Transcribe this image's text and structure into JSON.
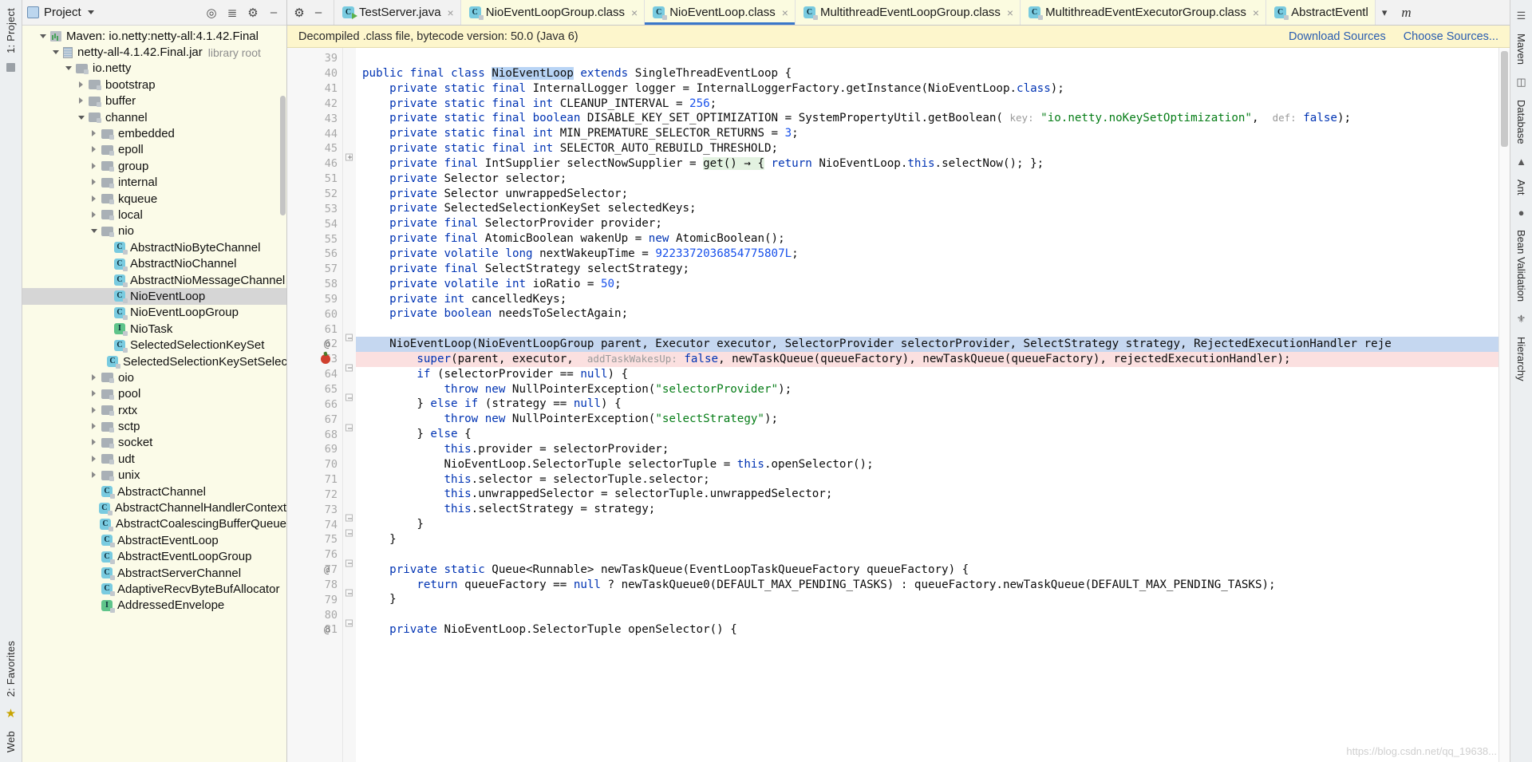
{
  "left_toolbar": {
    "top_label": "1: Project",
    "bottom_labels": [
      "2: Favorites",
      "Web"
    ]
  },
  "project_panel": {
    "title": "Project",
    "icons": [
      "target-icon",
      "collapse-all-icon",
      "settings-gear-icon",
      "hide-icon"
    ],
    "tree": [
      {
        "depth": 1,
        "twisty": "down",
        "icon": "maven-icon",
        "label": "Maven: io.netty:netty-all:4.1.42.Final",
        "dim": ""
      },
      {
        "depth": 2,
        "twisty": "down",
        "icon": "jar-icon",
        "label": "netty-all-4.1.42.Final.jar",
        "dim": "library root"
      },
      {
        "depth": 3,
        "twisty": "down",
        "icon": "folder-icon",
        "label": "io.netty",
        "dim": ""
      },
      {
        "depth": 4,
        "twisty": "right",
        "icon": "folder-icon",
        "label": "bootstrap",
        "dim": ""
      },
      {
        "depth": 4,
        "twisty": "right",
        "icon": "folder-icon",
        "label": "buffer",
        "dim": ""
      },
      {
        "depth": 4,
        "twisty": "down",
        "icon": "folder-icon",
        "label": "channel",
        "dim": ""
      },
      {
        "depth": 5,
        "twisty": "right",
        "icon": "folder-icon",
        "label": "embedded",
        "dim": ""
      },
      {
        "depth": 5,
        "twisty": "right",
        "icon": "folder-icon",
        "label": "epoll",
        "dim": ""
      },
      {
        "depth": 5,
        "twisty": "right",
        "icon": "folder-icon",
        "label": "group",
        "dim": ""
      },
      {
        "depth": 5,
        "twisty": "right",
        "icon": "folder-icon",
        "label": "internal",
        "dim": ""
      },
      {
        "depth": 5,
        "twisty": "right",
        "icon": "folder-icon",
        "label": "kqueue",
        "dim": ""
      },
      {
        "depth": 5,
        "twisty": "right",
        "icon": "folder-icon",
        "label": "local",
        "dim": ""
      },
      {
        "depth": 5,
        "twisty": "down",
        "icon": "folder-icon",
        "label": "nio",
        "dim": ""
      },
      {
        "depth": 6,
        "twisty": "none",
        "icon": "class-icon",
        "label": "AbstractNioByteChannel",
        "dim": ""
      },
      {
        "depth": 6,
        "twisty": "none",
        "icon": "class-icon",
        "label": "AbstractNioChannel",
        "dim": ""
      },
      {
        "depth": 6,
        "twisty": "none",
        "icon": "class-icon",
        "label": "AbstractNioMessageChannel",
        "dim": ""
      },
      {
        "depth": 6,
        "twisty": "none",
        "icon": "class-icon",
        "label": "NioEventLoop",
        "dim": "",
        "selected": true
      },
      {
        "depth": 6,
        "twisty": "none",
        "icon": "class-icon",
        "label": "NioEventLoopGroup",
        "dim": ""
      },
      {
        "depth": 6,
        "twisty": "none",
        "icon": "interface-icon",
        "label": "NioTask",
        "dim": ""
      },
      {
        "depth": 6,
        "twisty": "none",
        "icon": "class-icon",
        "label": "SelectedSelectionKeySet",
        "dim": ""
      },
      {
        "depth": 6,
        "twisty": "none",
        "icon": "class-icon",
        "label": "SelectedSelectionKeySetSelect",
        "dim": ""
      },
      {
        "depth": 5,
        "twisty": "right",
        "icon": "folder-icon",
        "label": "oio",
        "dim": ""
      },
      {
        "depth": 5,
        "twisty": "right",
        "icon": "folder-icon",
        "label": "pool",
        "dim": ""
      },
      {
        "depth": 5,
        "twisty": "right",
        "icon": "folder-icon",
        "label": "rxtx",
        "dim": ""
      },
      {
        "depth": 5,
        "twisty": "right",
        "icon": "folder-icon",
        "label": "sctp",
        "dim": ""
      },
      {
        "depth": 5,
        "twisty": "right",
        "icon": "folder-icon",
        "label": "socket",
        "dim": ""
      },
      {
        "depth": 5,
        "twisty": "right",
        "icon": "folder-icon",
        "label": "udt",
        "dim": ""
      },
      {
        "depth": 5,
        "twisty": "right",
        "icon": "folder-icon",
        "label": "unix",
        "dim": ""
      },
      {
        "depth": 5,
        "twisty": "none",
        "icon": "class-icon",
        "label": "AbstractChannel",
        "dim": ""
      },
      {
        "depth": 5,
        "twisty": "none",
        "icon": "class-icon",
        "label": "AbstractChannelHandlerContext",
        "dim": ""
      },
      {
        "depth": 5,
        "twisty": "none",
        "icon": "class-icon",
        "label": "AbstractCoalescingBufferQueue",
        "dim": ""
      },
      {
        "depth": 5,
        "twisty": "none",
        "icon": "class-icon",
        "label": "AbstractEventLoop",
        "dim": ""
      },
      {
        "depth": 5,
        "twisty": "none",
        "icon": "class-icon",
        "label": "AbstractEventLoopGroup",
        "dim": ""
      },
      {
        "depth": 5,
        "twisty": "none",
        "icon": "class-icon",
        "label": "AbstractServerChannel",
        "dim": ""
      },
      {
        "depth": 5,
        "twisty": "none",
        "icon": "class-icon",
        "label": "AdaptiveRecvByteBufAllocator",
        "dim": ""
      },
      {
        "depth": 5,
        "twisty": "none",
        "icon": "interface-icon",
        "label": "AddressedEnvelope",
        "dim": ""
      }
    ]
  },
  "tabs": [
    {
      "label": "TestServer.java",
      "icon": "java-run-icon",
      "active": false,
      "closable": true
    },
    {
      "label": "NioEventLoopGroup.class",
      "icon": "class-file-icon",
      "active": false,
      "closable": true
    },
    {
      "label": "NioEventLoop.class",
      "icon": "class-file-icon",
      "active": true,
      "closable": true
    },
    {
      "label": "MultithreadEventLoopGroup.class",
      "icon": "class-file-icon",
      "active": false,
      "closable": true
    },
    {
      "label": "MultithreadEventExecutorGroup.class",
      "icon": "class-file-icon",
      "active": false,
      "closable": true
    },
    {
      "label": "AbstractEventl",
      "icon": "class-file-icon",
      "active": false,
      "closable": false
    }
  ],
  "tab_overflow_icon": "chevron-down-icon",
  "tab_end_label": "m",
  "notice": {
    "text": "Decompiled .class file, bytecode version: 50.0 (Java 6)",
    "download_sources": "Download Sources",
    "choose_sources": "Choose Sources..."
  },
  "editor": {
    "watermark": "https://blog.csdn.net/qq_19638...",
    "lines": [
      {
        "n": "39",
        "mark": "",
        "fold": "",
        "html": "",
        "state": ""
      },
      {
        "n": "40",
        "mark": "",
        "fold": "",
        "html": "<span class='kw'>public</span> <span class='kw'>final</span> <span class='kw'>class</span> <span class='hl'>NioEventLoop</span> <span class='kw'>extends</span> SingleThreadEventLoop {",
        "state": ""
      },
      {
        "n": "41",
        "mark": "",
        "fold": "",
        "html": "    <span class='kw'>private</span> <span class='kw'>static</span> <span class='kw'>final</span> InternalLogger logger = InternalLoggerFactory.getInstance(NioEventLoop.<span class='kw'>class</span>);",
        "state": ""
      },
      {
        "n": "42",
        "mark": "",
        "fold": "",
        "html": "    <span class='kw'>private</span> <span class='kw'>static</span> <span class='kw'>final</span> <span class='kw'>int</span> CLEANUP_INTERVAL = <span class='num'>256</span>;",
        "state": ""
      },
      {
        "n": "43",
        "mark": "",
        "fold": "",
        "html": "    <span class='kw'>private</span> <span class='kw'>static</span> <span class='kw'>final</span> <span class='kw'>boolean</span> DISABLE_KEY_SET_OPTIMIZATION = SystemPropertyUtil.getBoolean( <span class='hint'>key:</span> <span class='str'>\"io.netty.noKeySetOptimization\"</span>,  <span class='hint'>def:</span> <span class='kw'>false</span>);",
        "state": ""
      },
      {
        "n": "44",
        "mark": "",
        "fold": "",
        "html": "    <span class='kw'>private</span> <span class='kw'>static</span> <span class='kw'>final</span> <span class='kw'>int</span> MIN_PREMATURE_SELECTOR_RETURNS = <span class='num'>3</span>;",
        "state": ""
      },
      {
        "n": "45",
        "mark": "",
        "fold": "",
        "html": "    <span class='kw'>private</span> <span class='kw'>static</span> <span class='kw'>final</span> <span class='kw'>int</span> SELECTOR_AUTO_REBUILD_THRESHOLD;",
        "state": ""
      },
      {
        "n": "46",
        "mark": "",
        "fold": "plus",
        "html": "    <span class='kw'>private</span> <span class='kw'>final</span> IntSupplier selectNowSupplier = <span class='lam'>get() → {</span> <span class='kw'>return</span> NioEventLoop.<span class='kw'>this</span>.selectNow(); };",
        "state": ""
      },
      {
        "n": "51",
        "mark": "",
        "fold": "",
        "html": "    <span class='kw'>private</span> Selector selector;",
        "state": ""
      },
      {
        "n": "52",
        "mark": "",
        "fold": "",
        "html": "    <span class='kw'>private</span> Selector unwrappedSelector;",
        "state": ""
      },
      {
        "n": "53",
        "mark": "",
        "fold": "",
        "html": "    <span class='kw'>private</span> SelectedSelectionKeySet selectedKeys;",
        "state": ""
      },
      {
        "n": "54",
        "mark": "",
        "fold": "",
        "html": "    <span class='kw'>private</span> <span class='kw'>final</span> SelectorProvider provider;",
        "state": ""
      },
      {
        "n": "55",
        "mark": "",
        "fold": "",
        "html": "    <span class='kw'>private</span> <span class='kw'>final</span> AtomicBoolean wakenUp = <span class='kw'>new</span> AtomicBoolean();",
        "state": ""
      },
      {
        "n": "56",
        "mark": "",
        "fold": "",
        "html": "    <span class='kw'>private</span> <span class='kw'>volatile</span> <span class='kw'>long</span> nextWakeupTime = <span class='num'>9223372036854775807L</span>;",
        "state": ""
      },
      {
        "n": "57",
        "mark": "",
        "fold": "",
        "html": "    <span class='kw'>private</span> <span class='kw'>final</span> SelectStrategy selectStrategy;",
        "state": ""
      },
      {
        "n": "58",
        "mark": "",
        "fold": "",
        "html": "    <span class='kw'>private</span> <span class='kw'>volatile</span> <span class='kw'>int</span> ioRatio = <span class='num'>50</span>;",
        "state": ""
      },
      {
        "n": "59",
        "mark": "",
        "fold": "",
        "html": "    <span class='kw'>private</span> <span class='kw'>int</span> cancelledKeys;",
        "state": ""
      },
      {
        "n": "60",
        "mark": "",
        "fold": "",
        "html": "    <span class='kw'>private</span> <span class='kw'>boolean</span> needsToSelectAgain;",
        "state": ""
      },
      {
        "n": "61",
        "mark": "",
        "fold": "",
        "html": "",
        "state": ""
      },
      {
        "n": "62",
        "mark": "@",
        "fold": "minus",
        "html": "    NioEventLoop(NioEventLoopGroup parent, Executor executor, SelectorProvider selectorProvider, SelectStrategy strategy, RejectedExecutionHandler reje",
        "state": "sel"
      },
      {
        "n": "63",
        "mark": "bp",
        "fold": "",
        "html": "        <span class='kw'>super</span>(parent, executor,  <span class='hint'>addTaskWakesUp:</span> <span class='kw'>false</span>, newTaskQueue(queueFactory), newTaskQueue(queueFactory), rejectedExecutionHandler);",
        "state": "bpline"
      },
      {
        "n": "64",
        "mark": "",
        "fold": "minus",
        "html": "        <span class='kw'>if</span> (selectorProvider == <span class='kw'>null</span>) {",
        "state": ""
      },
      {
        "n": "65",
        "mark": "",
        "fold": "",
        "html": "            <span class='kw'>throw</span> <span class='kw'>new</span> NullPointerException(<span class='str'>\"selectorProvider\"</span>);",
        "state": ""
      },
      {
        "n": "66",
        "mark": "",
        "fold": "minus",
        "html": "        } <span class='kw'>else</span> <span class='kw'>if</span> (strategy == <span class='kw'>null</span>) {",
        "state": ""
      },
      {
        "n": "67",
        "mark": "",
        "fold": "",
        "html": "            <span class='kw'>throw</span> <span class='kw'>new</span> NullPointerException(<span class='str'>\"selectStrategy\"</span>);",
        "state": ""
      },
      {
        "n": "68",
        "mark": "",
        "fold": "minus",
        "html": "        } <span class='kw'>else</span> {",
        "state": ""
      },
      {
        "n": "69",
        "mark": "",
        "fold": "",
        "html": "            <span class='kw'>this</span>.provider = selectorProvider;",
        "state": ""
      },
      {
        "n": "70",
        "mark": "",
        "fold": "",
        "html": "            NioEventLoop.SelectorTuple selectorTuple = <span class='kw'>this</span>.openSelector();",
        "state": ""
      },
      {
        "n": "71",
        "mark": "",
        "fold": "",
        "html": "            <span class='kw'>this</span>.selector = selectorTuple.selector;",
        "state": ""
      },
      {
        "n": "72",
        "mark": "",
        "fold": "",
        "html": "            <span class='kw'>this</span>.unwrappedSelector = selectorTuple.unwrappedSelector;",
        "state": ""
      },
      {
        "n": "73",
        "mark": "",
        "fold": "",
        "html": "            <span class='kw'>this</span>.selectStrategy = strategy;",
        "state": ""
      },
      {
        "n": "74",
        "mark": "",
        "fold": "minus",
        "html": "        }",
        "state": ""
      },
      {
        "n": "75",
        "mark": "",
        "fold": "minus",
        "html": "    }",
        "state": ""
      },
      {
        "n": "76",
        "mark": "",
        "fold": "",
        "html": "",
        "state": ""
      },
      {
        "n": "77",
        "mark": "@",
        "fold": "minus",
        "html": "    <span class='kw'>private</span> <span class='kw'>static</span> Queue&lt;Runnable&gt; newTaskQueue(EventLoopTaskQueueFactory queueFactory) {",
        "state": ""
      },
      {
        "n": "78",
        "mark": "",
        "fold": "",
        "html": "        <span class='kw'>return</span> queueFactory == <span class='kw'>null</span> ? newTaskQueue0(DEFAULT_MAX_PENDING_TASKS) : queueFactory.newTaskQueue(DEFAULT_MAX_PENDING_TASKS);",
        "state": ""
      },
      {
        "n": "79",
        "mark": "",
        "fold": "minus",
        "html": "    }",
        "state": ""
      },
      {
        "n": "80",
        "mark": "",
        "fold": "",
        "html": "",
        "state": ""
      },
      {
        "n": "81",
        "mark": "@",
        "fold": "minus",
        "html": "    <span class='kw'>private</span> NioEventLoop.SelectorTuple openSelector() {",
        "state": ""
      }
    ]
  },
  "right_toolbar": {
    "labels": [
      "Maven",
      "Database",
      "Ant",
      "Bean Validation",
      "Hierarchy"
    ]
  }
}
